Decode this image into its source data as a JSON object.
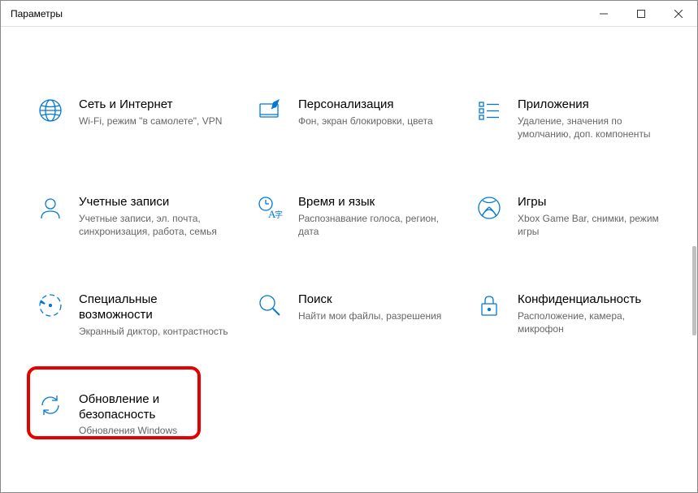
{
  "window": {
    "title": "Параметры"
  },
  "tiles": {
    "network": {
      "title": "Сеть и Интернет",
      "desc": "Wi-Fi, режим \"в самолете\", VPN"
    },
    "personal": {
      "title": "Персонализация",
      "desc": "Фон, экран блокировки, цвета"
    },
    "apps": {
      "title": "Приложения",
      "desc": "Удаление, значения по умолчанию, доп. компоненты"
    },
    "accounts": {
      "title": "Учетные записи",
      "desc": "Учетные записи, эл. почта, синхронизация, работа, семья"
    },
    "timelang": {
      "title": "Время и язык",
      "desc": "Распознавание голоса, регион, дата"
    },
    "gaming": {
      "title": "Игры",
      "desc": "Xbox Game Bar, снимки, режим игры"
    },
    "access": {
      "title": "Специальные возможности",
      "desc": "Экранный диктор, контрастность"
    },
    "search": {
      "title": "Поиск",
      "desc": "Найти мои файлы, разрешения"
    },
    "privacy": {
      "title": "Конфиденциальность",
      "desc": "Расположение, камера, микрофон"
    },
    "update": {
      "title": "Обновление и безопасность",
      "desc": "Обновления Windows"
    }
  },
  "colors": {
    "accent": "#0078d4",
    "highlight": "#e60000"
  }
}
